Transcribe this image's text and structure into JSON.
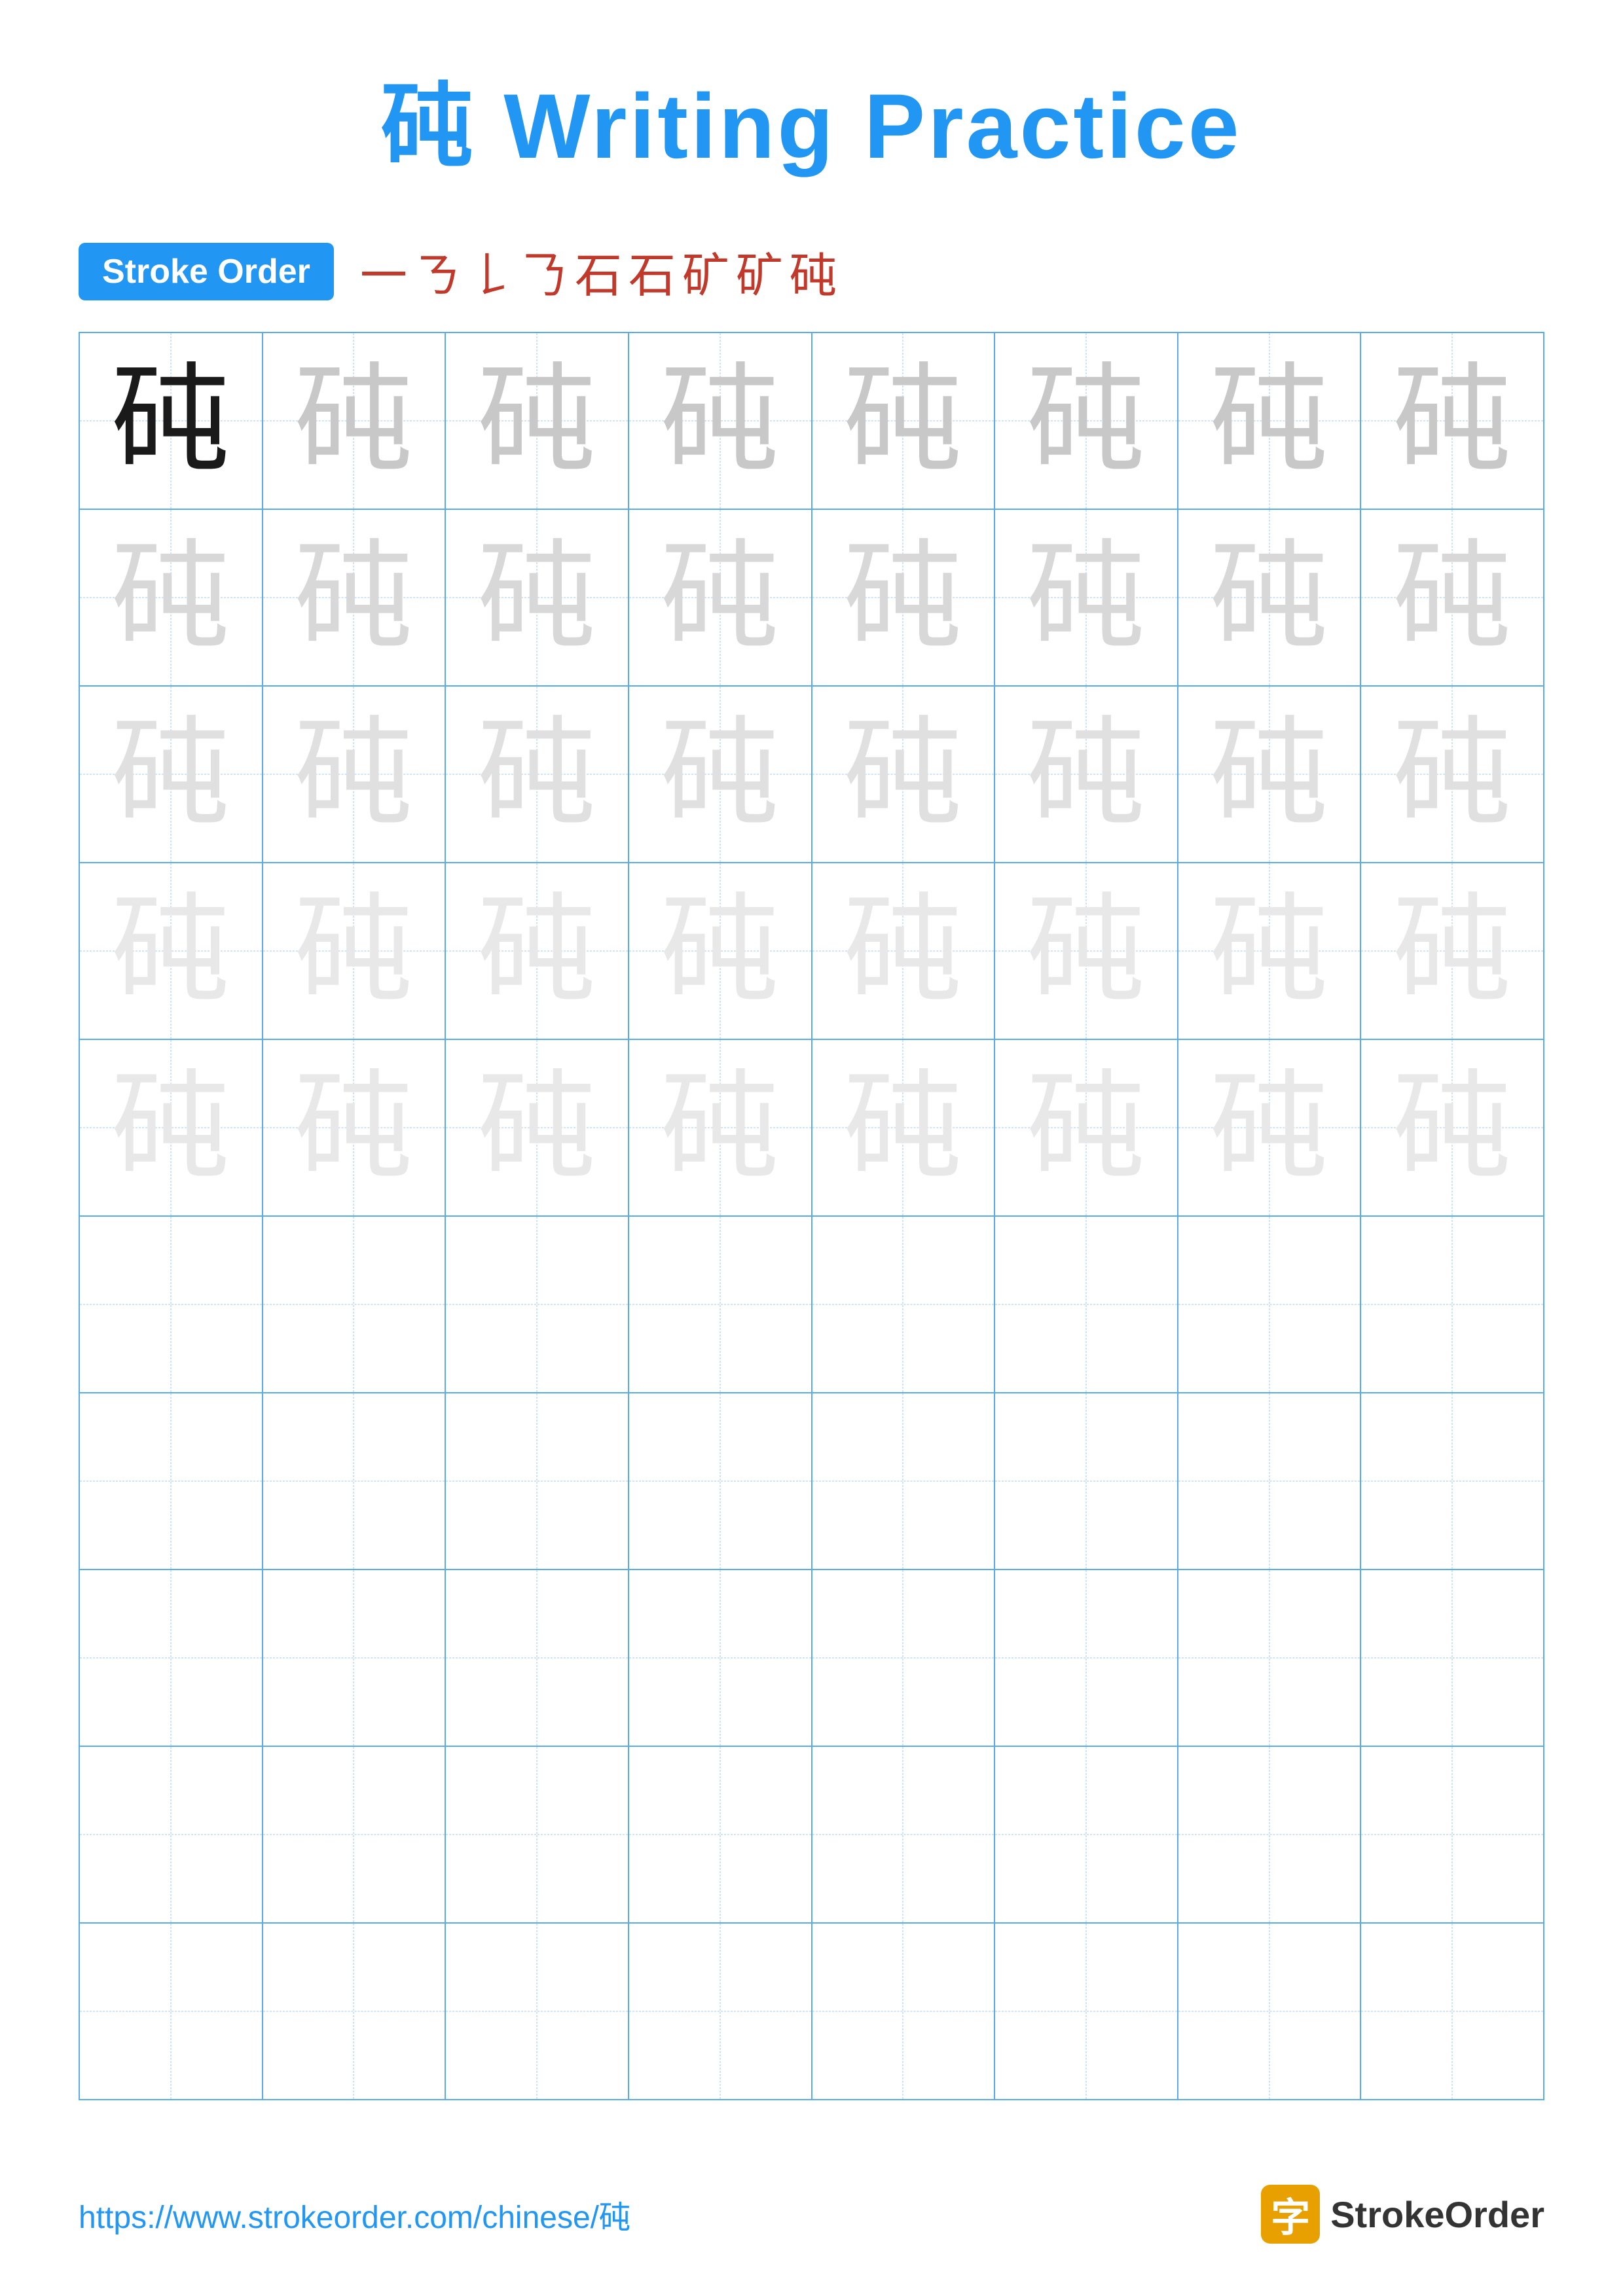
{
  "title": "砘 Writing Practice",
  "stroke_order": {
    "badge_label": "Stroke Order",
    "strokes": [
      "㇐",
      "𠃌",
      "𠄌",
      "𠄎",
      "石",
      "石",
      "矿",
      "矿",
      "砘"
    ]
  },
  "character": "砘",
  "grid": {
    "cols": 8,
    "rows": 10,
    "practice_rows_with_char": 5,
    "empty_rows": 5
  },
  "footer": {
    "url": "https://www.strokeorder.com/chinese/砘",
    "logo_char": "字",
    "logo_text": "StrokeOrder"
  }
}
